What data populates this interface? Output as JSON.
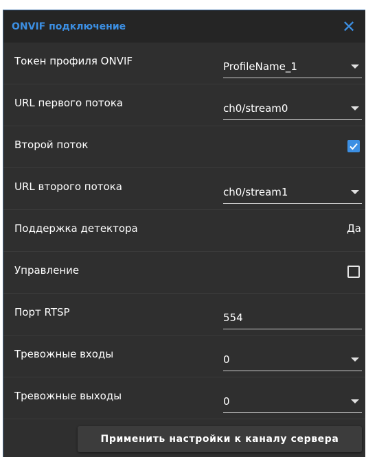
{
  "dialog": {
    "title": "ONVIF подключение",
    "close_icon": "close-icon",
    "accent": "#3c8fe3"
  },
  "rows": {
    "profile_token": {
      "label": "Токен профиля ONVIF",
      "value": "ProfileName_1"
    },
    "stream1_url": {
      "label": "URL первого потока",
      "value": "ch0/stream0"
    },
    "second_stream": {
      "label": "Второй поток",
      "checked": true
    },
    "stream2_url": {
      "label": "URL второго потока",
      "value": "ch0/stream1"
    },
    "detector_support": {
      "label": "Поддержка детектора",
      "value": "Да"
    },
    "control": {
      "label": "Управление",
      "checked": false
    },
    "rtsp_port": {
      "label": "Порт RTSP",
      "value": "554"
    },
    "alarm_inputs": {
      "label": "Тревожные входы",
      "value": "0"
    },
    "alarm_outputs": {
      "label": "Тревожные выходы",
      "value": "0"
    }
  },
  "footer": {
    "apply_label": "Применить настройки к каналу сервера"
  }
}
